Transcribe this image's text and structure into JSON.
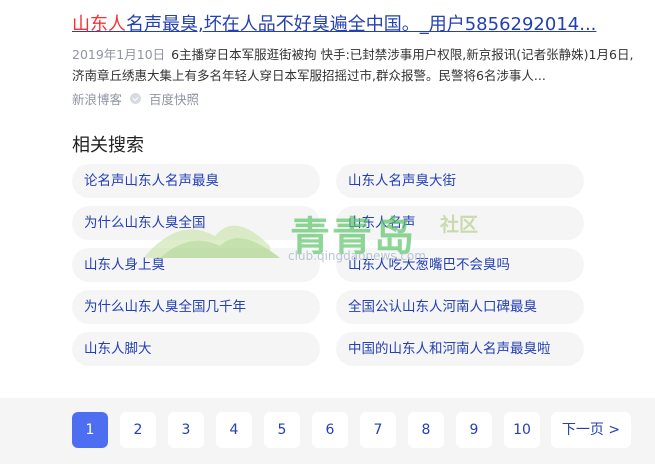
{
  "result": {
    "title_highlight": "山东人",
    "title_rest": "名声最臭,坏在人品不好臭遍全中国。_用户5856292014...",
    "date": "2019年1月10日",
    "snippet": "6主播穿日本军服逛街被拘 快手:已封禁涉事用户权限,新京报讯(记者张静姝)1月6日,济南章丘绣惠大集上有多名年轻人穿日本军服招摇过市,群众报警。民警将6名涉事人...",
    "source": "新浪博客",
    "cache": "百度快照"
  },
  "related": {
    "title": "相关搜索",
    "items": [
      "论名声山东人名声最臭",
      "山东人名声臭大街",
      "为什么山东人臭全国",
      "山东人名声",
      "山东人身上臭",
      "山东人吃大葱嘴巴不会臭吗",
      "为什么山东人臭全国几千年",
      "全国公认山东人河南人口碑最臭",
      "山东人脚大",
      "中国的山东人和河南人名声最臭啦"
    ]
  },
  "watermark": {
    "text": "青青岛",
    "sub": "社区",
    "url": "club.qingdaonews.com"
  },
  "pagination": {
    "pages": [
      "1",
      "2",
      "3",
      "4",
      "5",
      "6",
      "7",
      "8",
      "9",
      "10"
    ],
    "current": "1",
    "next": "下一页 >"
  }
}
